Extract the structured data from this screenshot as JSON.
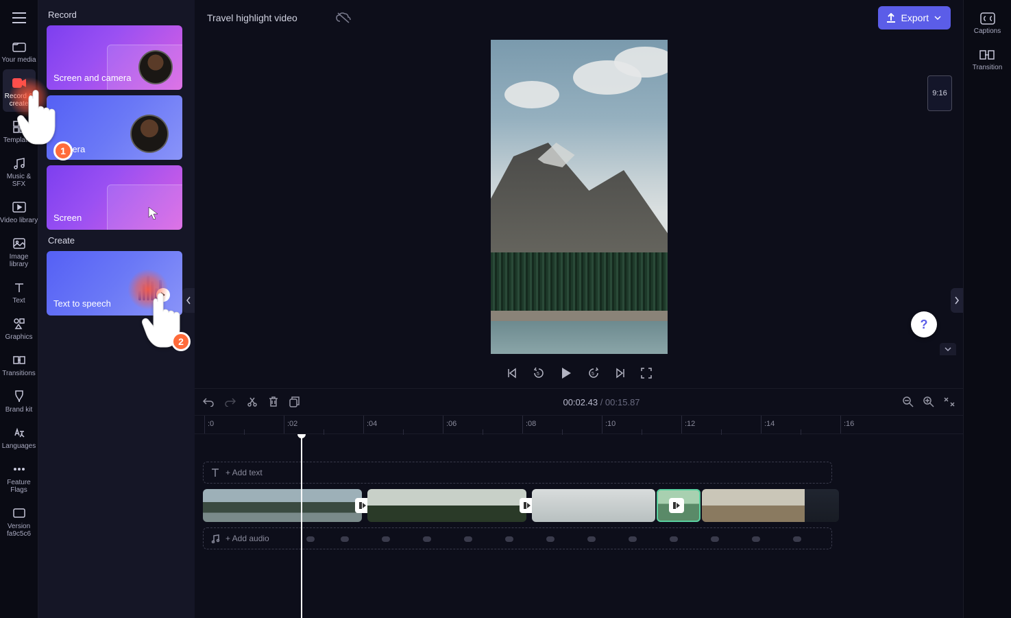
{
  "rail": {
    "items": [
      {
        "label": "Your media"
      },
      {
        "label": "Record & create"
      },
      {
        "label": "Templates"
      },
      {
        "label": "Music & SFX"
      },
      {
        "label": "Video library"
      },
      {
        "label": "Image library"
      },
      {
        "label": "Text"
      },
      {
        "label": "Graphics"
      },
      {
        "label": "Transitions"
      },
      {
        "label": "Brand kit"
      },
      {
        "label": "Languages"
      },
      {
        "label": "Feature Flags"
      },
      {
        "label": "Version fa9c5c6"
      }
    ]
  },
  "panel": {
    "section_record": "Record",
    "section_create": "Create",
    "cards": {
      "screen_camera": "Screen and camera",
      "camera": "Camera",
      "screen": "Screen",
      "tts": "Text to speech"
    }
  },
  "tutorial": {
    "step1": "1",
    "step2": "2"
  },
  "topbar": {
    "title": "Travel highlight video",
    "export": "Export"
  },
  "preview": {
    "aspect": "9:16"
  },
  "timeline": {
    "current": "00:02.43",
    "separator": " / ",
    "duration": "00:15.87",
    "add_text": "+ Add text",
    "add_audio": "+ Add audio",
    "ruler": [
      ":0",
      ":02",
      ":04",
      ":06",
      ":08",
      ":10",
      ":12",
      ":14",
      ":16"
    ]
  },
  "rrail": {
    "captions": "Captions",
    "transition": "Transition"
  }
}
